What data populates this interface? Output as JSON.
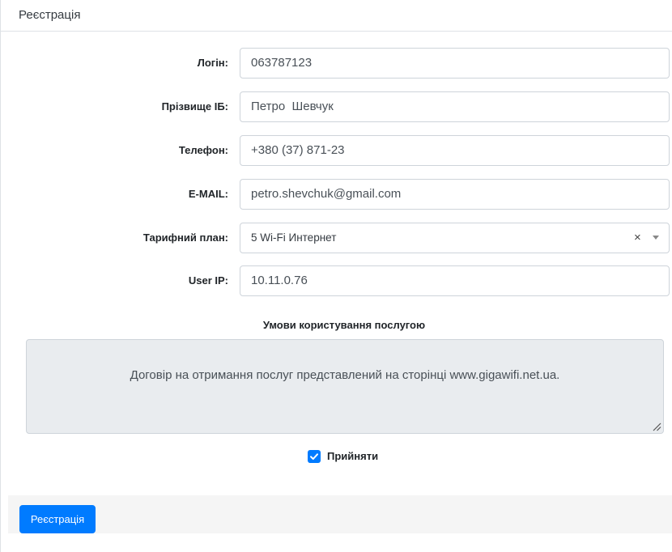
{
  "header": {
    "title": "Реєстрація"
  },
  "form": {
    "login": {
      "label": "Логін:",
      "value": "063787123"
    },
    "name": {
      "label": "Прізвище ІБ:",
      "value": "Петро  Шевчук"
    },
    "phone": {
      "label": "Телефон:",
      "value": "+380 (37) 871-23"
    },
    "email": {
      "label": "E-MAIL:",
      "value": "petro.shevchuk@gmail.com"
    },
    "tariff": {
      "label": "Тарифний план:",
      "value": "5 Wi-Fi Интернет",
      "clear": "×"
    },
    "ip": {
      "label": "User IP:",
      "value": "10.11.0.76"
    }
  },
  "terms": {
    "title": "Умови користування послугою",
    "text": "Договір на отримання послуг представлений на сторінці www.gigawifi.net.ua."
  },
  "accept": {
    "label": "Прийняти",
    "checked": true
  },
  "footer": {
    "submit_label": "Реєстрація"
  },
  "colors": {
    "primary": "#007bff",
    "textarea_bg": "#e9ecef",
    "footer_bg": "#f5f5f5"
  },
  "icons": {
    "checkbox": "check-icon",
    "dropdown": "chevron-down-icon",
    "resize": "resize-handle-icon"
  }
}
